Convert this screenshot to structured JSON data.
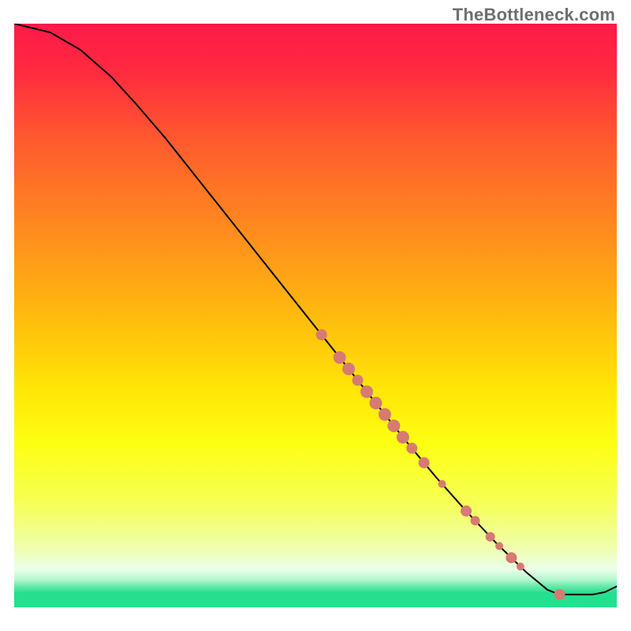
{
  "watermark": "TheBottleneck.com",
  "chart_data": {
    "type": "line",
    "title": "",
    "xlabel": "",
    "ylabel": "",
    "xlim": [
      0,
      100
    ],
    "ylim": [
      0,
      100
    ],
    "gradient_stops": [
      {
        "offset": 0.0,
        "color": "#ff1a49"
      },
      {
        "offset": 0.08,
        "color": "#ff2a3f"
      },
      {
        "offset": 0.2,
        "color": "#ff5a2e"
      },
      {
        "offset": 0.35,
        "color": "#ff8a1e"
      },
      {
        "offset": 0.5,
        "color": "#ffba0e"
      },
      {
        "offset": 0.62,
        "color": "#ffe406"
      },
      {
        "offset": 0.72,
        "color": "#fdff12"
      },
      {
        "offset": 0.82,
        "color": "#f6ff55"
      },
      {
        "offset": 0.9,
        "color": "#efffb0"
      },
      {
        "offset": 0.935,
        "color": "#eaffea"
      },
      {
        "offset": 0.952,
        "color": "#b6f8cf"
      },
      {
        "offset": 0.965,
        "color": "#60e8a8"
      },
      {
        "offset": 0.975,
        "color": "#26df8e"
      },
      {
        "offset": 1.0,
        "color": "#26df8e"
      }
    ],
    "curve": [
      {
        "x": 0.0,
        "y": 100.0
      },
      {
        "x": 6.0,
        "y": 98.5
      },
      {
        "x": 11.0,
        "y": 95.5
      },
      {
        "x": 16.0,
        "y": 91.0
      },
      {
        "x": 20.0,
        "y": 86.5
      },
      {
        "x": 25.0,
        "y": 80.5
      },
      {
        "x": 30.0,
        "y": 74.0
      },
      {
        "x": 35.0,
        "y": 67.5
      },
      {
        "x": 40.0,
        "y": 61.0
      },
      {
        "x": 45.0,
        "y": 54.5
      },
      {
        "x": 50.0,
        "y": 48.0
      },
      {
        "x": 55.0,
        "y": 41.5
      },
      {
        "x": 60.0,
        "y": 35.0
      },
      {
        "x": 65.0,
        "y": 28.5
      },
      {
        "x": 70.0,
        "y": 22.3
      },
      {
        "x": 75.0,
        "y": 16.5
      },
      {
        "x": 80.0,
        "y": 11.0
      },
      {
        "x": 85.0,
        "y": 6.0
      },
      {
        "x": 88.5,
        "y": 3.0
      },
      {
        "x": 90.5,
        "y": 2.2
      },
      {
        "x": 96.0,
        "y": 2.2
      },
      {
        "x": 98.0,
        "y": 2.6
      },
      {
        "x": 100.0,
        "y": 3.6
      }
    ],
    "markers": [
      {
        "x": 51.0,
        "r": 7
      },
      {
        "x": 54.0,
        "r": 8
      },
      {
        "x": 55.5,
        "r": 8
      },
      {
        "x": 57.0,
        "r": 7
      },
      {
        "x": 58.5,
        "r": 8
      },
      {
        "x": 60.0,
        "r": 8
      },
      {
        "x": 61.5,
        "r": 8
      },
      {
        "x": 63.0,
        "r": 8
      },
      {
        "x": 64.5,
        "r": 8
      },
      {
        "x": 66.0,
        "r": 7
      },
      {
        "x": 68.0,
        "r": 7
      },
      {
        "x": 71.0,
        "r": 5
      },
      {
        "x": 75.0,
        "r": 7
      },
      {
        "x": 76.5,
        "r": 6
      },
      {
        "x": 79.0,
        "r": 6
      },
      {
        "x": 80.5,
        "r": 5
      },
      {
        "x": 82.5,
        "r": 7
      },
      {
        "x": 84.0,
        "r": 5
      },
      {
        "x": 90.5,
        "r": 7
      }
    ],
    "marker_color": "#d77a73",
    "line_color": "#000000",
    "line_width": 2.0
  }
}
